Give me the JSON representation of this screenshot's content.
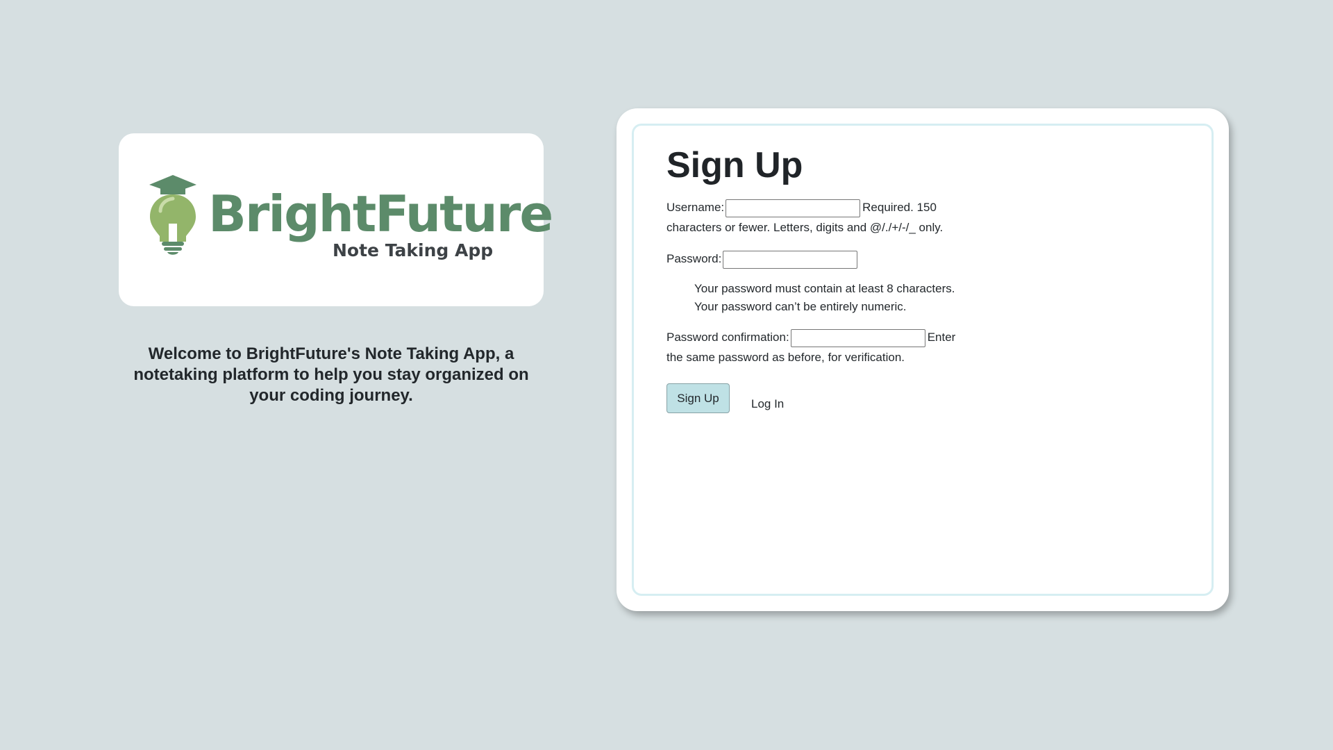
{
  "branding": {
    "name": "BrightFuture",
    "subtitle": "Note Taking App",
    "welcome": "Welcome to BrightFuture's Note Taking App, a notetaking platform to help you stay organized on your coding journey.",
    "colors": {
      "brand_green": "#5c8b6a",
      "bulb_green": "#93b56a",
      "background": "#d6dfe1"
    },
    "logo_icon": "lightbulb-graduation-cap-icon"
  },
  "form": {
    "title": "Sign Up",
    "username_label": "Username:",
    "username_value": "",
    "username_help": "Required. 150 characters or fewer. Letters, digits and @/./+/-/_ only.",
    "password_label": "Password:",
    "password_value": "",
    "password_help": [
      "Your password must contain at least 8 characters.",
      "Your password can’t be entirely numeric."
    ],
    "confirm_label": "Password confirmation:",
    "confirm_value": "",
    "confirm_help": "Enter the same password as before, for verification.",
    "submit_label": "Sign Up",
    "login_link": "Log In",
    "colors": {
      "button_bg": "#bfe1e5",
      "inner_border": "#d6eef2"
    }
  }
}
